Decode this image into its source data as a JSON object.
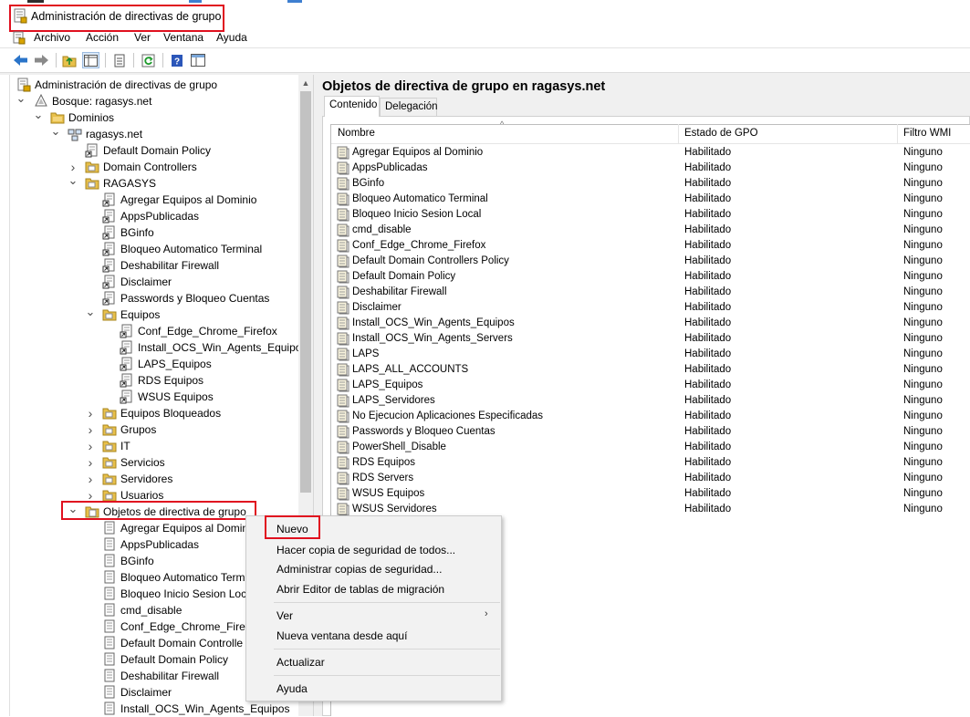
{
  "window": {
    "title": "Administración de directivas de grupo",
    "highlight_color": "#e0101f",
    "top_strip_colors": [
      "#2d2d2d",
      "#3e7fd0",
      "#3e7fd0"
    ]
  },
  "menu": [
    "Archivo",
    "Acción",
    "Ver",
    "Ventana",
    "Ayuda"
  ],
  "toolbar": {
    "buttons": [
      "back-arrow-icon",
      "forward-arrow-icon",
      "up-folder-icon",
      "show-hide-tree-icon",
      "properties-icon",
      "refresh-icon",
      "help-icon",
      "console-icon"
    ]
  },
  "tree": {
    "root": "Administración de directivas de grupo",
    "forest": "Bosque: ragasys.net",
    "domains": "Dominios",
    "domain": "ragasys.net",
    "items": [
      "Default Domain Policy",
      "Domain Controllers",
      "RAGASYS",
      "Agregar Equipos al Dominio",
      "AppsPublicadas",
      "BGinfo",
      "Bloqueo Automatico Terminal",
      "Deshabilitar Firewall",
      "Disclaimer",
      "Passwords y Bloqueo Cuentas",
      "Equipos",
      "Conf_Edge_Chrome_Firefox",
      "Install_OCS_Win_Agents_Equipos",
      "LAPS_Equipos",
      "RDS Equipos",
      "WSUS Equipos",
      "Equipos Bloqueados",
      "Grupos",
      "IT",
      "Servicios",
      "Servidores",
      "Usuarios",
      "Objetos de directiva de grupo",
      "Agregar Equipos al Domin",
      "AppsPublicadas",
      "BGinfo",
      "Bloqueo Automatico Term",
      "Bloqueo Inicio Sesion Loc",
      "cmd_disable",
      "Conf_Edge_Chrome_Firefo",
      "Default Domain Controlle",
      "Default Domain Policy",
      "Deshabilitar Firewall",
      "Disclaimer",
      "Install_OCS_Win_Agents_Equipos"
    ]
  },
  "right": {
    "title": "Objetos de directiva de grupo en ragasys.net",
    "tabs": [
      "Contenido",
      "Delegación"
    ],
    "columns": [
      "Nombre",
      "Estado de GPO",
      "Filtro WMI"
    ],
    "rows": [
      [
        "Agregar Equipos al Dominio",
        "Habilitado",
        "Ninguno"
      ],
      [
        "AppsPublicadas",
        "Habilitado",
        "Ninguno"
      ],
      [
        "BGinfo",
        "Habilitado",
        "Ninguno"
      ],
      [
        "Bloqueo Automatico Terminal",
        "Habilitado",
        "Ninguno"
      ],
      [
        "Bloqueo Inicio Sesion Local",
        "Habilitado",
        "Ninguno"
      ],
      [
        "cmd_disable",
        "Habilitado",
        "Ninguno"
      ],
      [
        "Conf_Edge_Chrome_Firefox",
        "Habilitado",
        "Ninguno"
      ],
      [
        "Default Domain Controllers Policy",
        "Habilitado",
        "Ninguno"
      ],
      [
        "Default Domain Policy",
        "Habilitado",
        "Ninguno"
      ],
      [
        "Deshabilitar Firewall",
        "Habilitado",
        "Ninguno"
      ],
      [
        "Disclaimer",
        "Habilitado",
        "Ninguno"
      ],
      [
        "Install_OCS_Win_Agents_Equipos",
        "Habilitado",
        "Ninguno"
      ],
      [
        "Install_OCS_Win_Agents_Servers",
        "Habilitado",
        "Ninguno"
      ],
      [
        "LAPS",
        "Habilitado",
        "Ninguno"
      ],
      [
        "LAPS_ALL_ACCOUNTS",
        "Habilitado",
        "Ninguno"
      ],
      [
        "LAPS_Equipos",
        "Habilitado",
        "Ninguno"
      ],
      [
        "LAPS_Servidores",
        "Habilitado",
        "Ninguno"
      ],
      [
        "No Ejecucion Aplicaciones Especificadas",
        "Habilitado",
        "Ninguno"
      ],
      [
        "Passwords y Bloqueo Cuentas",
        "Habilitado",
        "Ninguno"
      ],
      [
        "PowerShell_Disable",
        "Habilitado",
        "Ninguno"
      ],
      [
        "RDS Equipos",
        "Habilitado",
        "Ninguno"
      ],
      [
        "RDS Servers",
        "Habilitado",
        "Ninguno"
      ],
      [
        "WSUS Equipos",
        "Habilitado",
        "Ninguno"
      ],
      [
        "WSUS Servidores",
        "Habilitado",
        "Ninguno"
      ]
    ]
  },
  "context_menu": {
    "items": [
      "Nuevo",
      "Hacer copia de seguridad de todos...",
      "Administrar copias de seguridad...",
      "Abrir Editor de tablas de migración",
      "Ver",
      "Nueva ventana desde aquí",
      "Actualizar",
      "Ayuda"
    ]
  }
}
